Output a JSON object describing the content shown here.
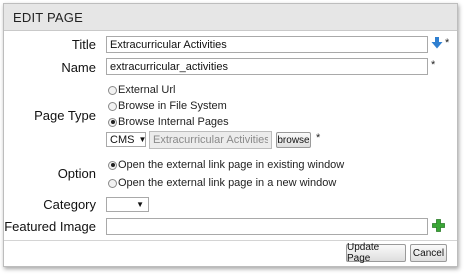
{
  "header": {
    "title": "EDIT PAGE"
  },
  "form": {
    "title": {
      "label": "Title",
      "value": "Extracurricular Activities",
      "required_mark": "*"
    },
    "name": {
      "label": "Name",
      "value": "extracurricular_activities",
      "required_mark": "*"
    },
    "page_type": {
      "label": "Page Type",
      "options": [
        {
          "label": "External Url",
          "checked": false
        },
        {
          "label": "Browse in File System",
          "checked": false
        },
        {
          "label": "Browse Internal Pages",
          "checked": true
        }
      ],
      "module_select": "CMS",
      "page_value": "Extracurricular Activities",
      "browse_label": "browse",
      "required_mark": "*"
    },
    "option": {
      "label": "Option",
      "options": [
        {
          "label": "Open the external link page in existing window",
          "checked": true
        },
        {
          "label": "Open the external link page in a new window",
          "checked": false
        }
      ]
    },
    "category": {
      "label": "Category",
      "selected": ""
    },
    "featured_image": {
      "label": "Featured Image",
      "value": ""
    }
  },
  "footer": {
    "update_label": "Update Page",
    "cancel_label": "Cancel"
  },
  "icons": {
    "title_action": "download-arrow-icon",
    "featured_add": "add-plus-icon"
  },
  "colors": {
    "arrow_blue": "#2f7fd0",
    "plus_green": "#3aa636",
    "header_bg": "#e6e6e6"
  }
}
